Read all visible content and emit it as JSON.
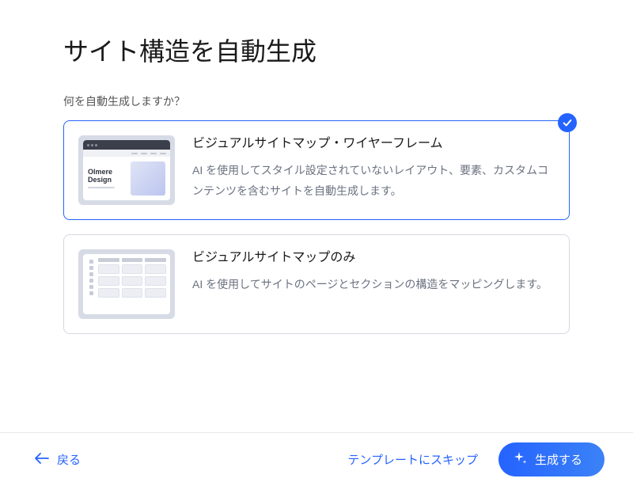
{
  "page": {
    "title": "サイト構造を自動生成",
    "prompt": "何を自動生成しますか？"
  },
  "options": {
    "wireframe": {
      "title": "ビジュアルサイトマップ・ワイヤーフレーム",
      "description": "AI を使用してスタイル設定されていないレイアウト、要素、カスタムコンテンツを含むサイトを自動生成します。",
      "thumb_brand": "Olmere Design",
      "selected": true
    },
    "sitemap": {
      "title": "ビジュアルサイトマップのみ",
      "description": "AI を使用してサイトのページとセクションの構造をマッピングします。",
      "selected": false
    }
  },
  "footer": {
    "back_label": "戻る",
    "skip_label": "テンプレートにスキップ",
    "generate_label": "生成する"
  },
  "colors": {
    "primary": "#2563ff"
  }
}
